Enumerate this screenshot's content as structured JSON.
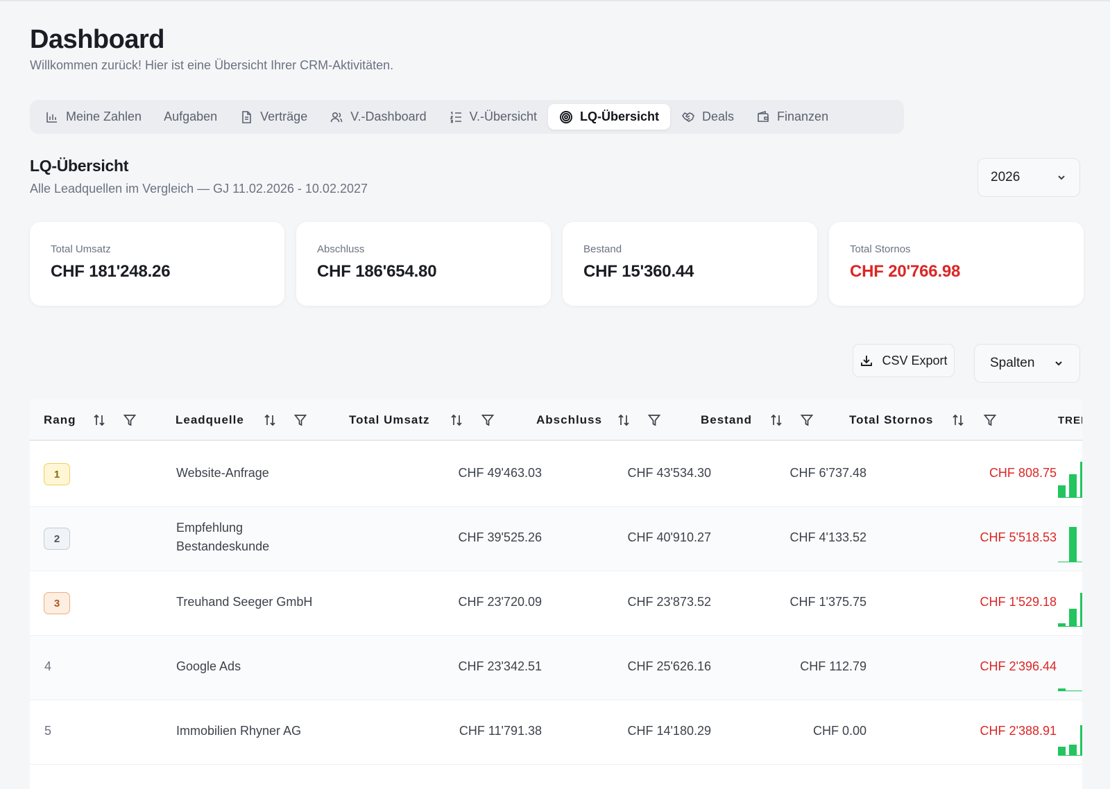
{
  "page": {
    "title": "Dashboard",
    "subtitle": "Willkommen zurück! Hier ist eine Übersicht Ihrer CRM-Aktivitäten."
  },
  "tabs": [
    {
      "label": "Meine Zahlen",
      "icon": "bar-chart-icon"
    },
    {
      "label": "Aufgaben",
      "icon": ""
    },
    {
      "label": "Verträge",
      "icon": "document-icon"
    },
    {
      "label": "V.-Dashboard",
      "icon": "users-icon"
    },
    {
      "label": "V.-Übersicht",
      "icon": "list-ordered-icon"
    },
    {
      "label": "LQ-Übersicht",
      "icon": "target-icon",
      "active": true
    },
    {
      "label": "Deals",
      "icon": "handshake-icon"
    },
    {
      "label": "Finanzen",
      "icon": "wallet-icon"
    }
  ],
  "section": {
    "title": "LQ-Übersicht",
    "subtitle": "Alle Leadquellen im Vergleich — GJ 11.02.2026 - 10.02.2027",
    "year": "2026"
  },
  "kpis": [
    {
      "label": "Total Umsatz",
      "value": "CHF 181'248.26",
      "color": "#1a1d23"
    },
    {
      "label": "Abschluss",
      "value": "CHF 186'654.80",
      "color": "#1a1d23"
    },
    {
      "label": "Bestand",
      "value": "CHF 15'360.44",
      "color": "#1a1d23"
    },
    {
      "label": "Total Stornos",
      "value": "CHF 20'766.98",
      "color": "#dc2626"
    }
  ],
  "toolbar": {
    "export_label": "CSV Export",
    "columns_label": "Spalten"
  },
  "table": {
    "columns": [
      "Rang",
      "Leadquelle",
      "Total Umsatz",
      "Abschluss",
      "Bestand",
      "Total Stornos",
      "TREND"
    ],
    "rows": [
      {
        "rank": "1",
        "badge": "gold",
        "source": "Website-Anfrage",
        "source2": "",
        "umsatz": "CHF 49'463.03",
        "abschluss": "CHF 43'534.30",
        "bestand": "CHF 6'737.48",
        "stornos": "CHF 808.75",
        "trend": [
          0.35,
          0.65,
          1.0
        ]
      },
      {
        "rank": "2",
        "badge": "silver",
        "source": "Empfehlung",
        "source2": "Bestandeskunde",
        "umsatz": "CHF 39'525.26",
        "abschluss": "CHF 40'910.27",
        "bestand": "CHF 4'133.52",
        "stornos": "CHF 5'518.53",
        "trend": [
          0,
          0.98,
          0
        ]
      },
      {
        "rank": "3",
        "badge": "bronze",
        "source": "Treuhand Seeger GmbH",
        "source2": "",
        "umsatz": "CHF 23'720.09",
        "abschluss": "CHF 23'873.52",
        "bestand": "CHF 1'375.75",
        "stornos": "CHF 1'529.18",
        "trend": [
          0.1,
          0.5,
          0.95
        ]
      },
      {
        "rank": "4",
        "badge": "",
        "source": "Google Ads",
        "source2": "",
        "umsatz": "CHF 23'342.51",
        "abschluss": "CHF 25'626.16",
        "bestand": "CHF 112.79",
        "stornos": "CHF 2'396.44",
        "trend": [
          0.08,
          0,
          0
        ]
      },
      {
        "rank": "5",
        "badge": "",
        "source": "Immobilien Rhyner AG",
        "source2": "",
        "umsatz": "CHF 11'791.38",
        "abschluss": "CHF 14'180.29",
        "bestand": "CHF 0.00",
        "stornos": "CHF 2'388.91",
        "trend": [
          0.25,
          0.3,
          0.85
        ]
      }
    ]
  }
}
